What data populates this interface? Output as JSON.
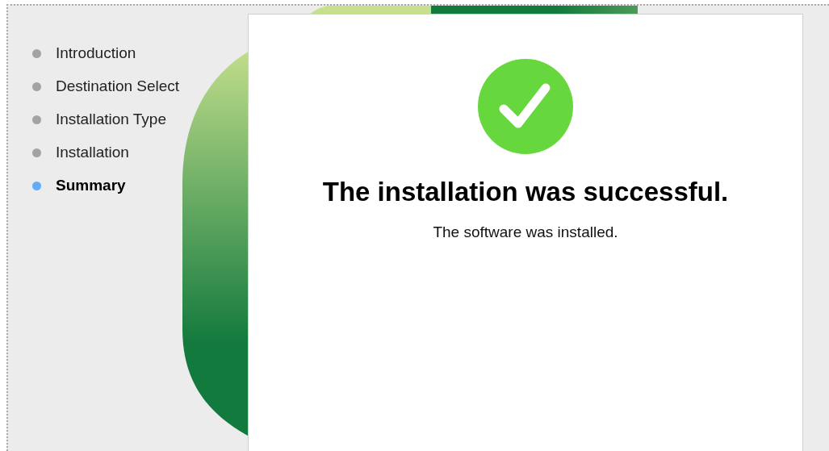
{
  "sidebar": {
    "items": [
      {
        "label": "Introduction",
        "selected": false
      },
      {
        "label": "Destination Select",
        "selected": false
      },
      {
        "label": "Installation Type",
        "selected": false
      },
      {
        "label": "Installation",
        "selected": false
      },
      {
        "label": "Summary",
        "selected": true
      }
    ]
  },
  "panel": {
    "kind": "success",
    "heading": "The installation was successful.",
    "message": "The software was installed."
  }
}
